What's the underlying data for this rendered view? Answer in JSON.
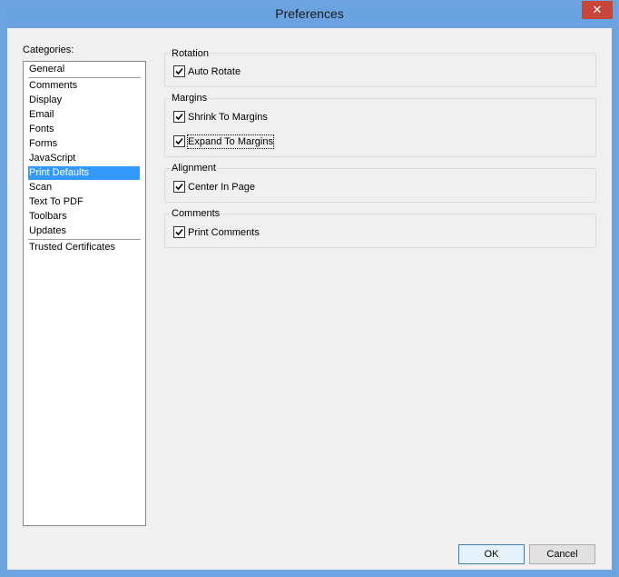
{
  "window": {
    "title": "Preferences",
    "close_glyph": "✕"
  },
  "categories": {
    "label": "Categories:",
    "items": [
      "General",
      "Comments",
      "Display",
      "Email",
      "Fonts",
      "Forms",
      "JavaScript",
      "Print Defaults",
      "Scan",
      "Text To PDF",
      "Toolbars",
      "Updates",
      "Trusted Certificates"
    ],
    "selected": "Print Defaults"
  },
  "groups": {
    "rotation": {
      "title": "Rotation",
      "auto_rotate": "Auto Rotate"
    },
    "margins": {
      "title": "Margins",
      "shrink": "Shrink To Margins",
      "expand": "Expand To Margins"
    },
    "alignment": {
      "title": "Alignment",
      "center": "Center In Page"
    },
    "comments": {
      "title": "Comments",
      "print": "Print Comments"
    }
  },
  "checkbox_states": {
    "auto_rotate": true,
    "shrink": true,
    "expand": true,
    "center": true,
    "print_comments": true
  },
  "buttons": {
    "ok": "OK",
    "cancel": "Cancel"
  }
}
